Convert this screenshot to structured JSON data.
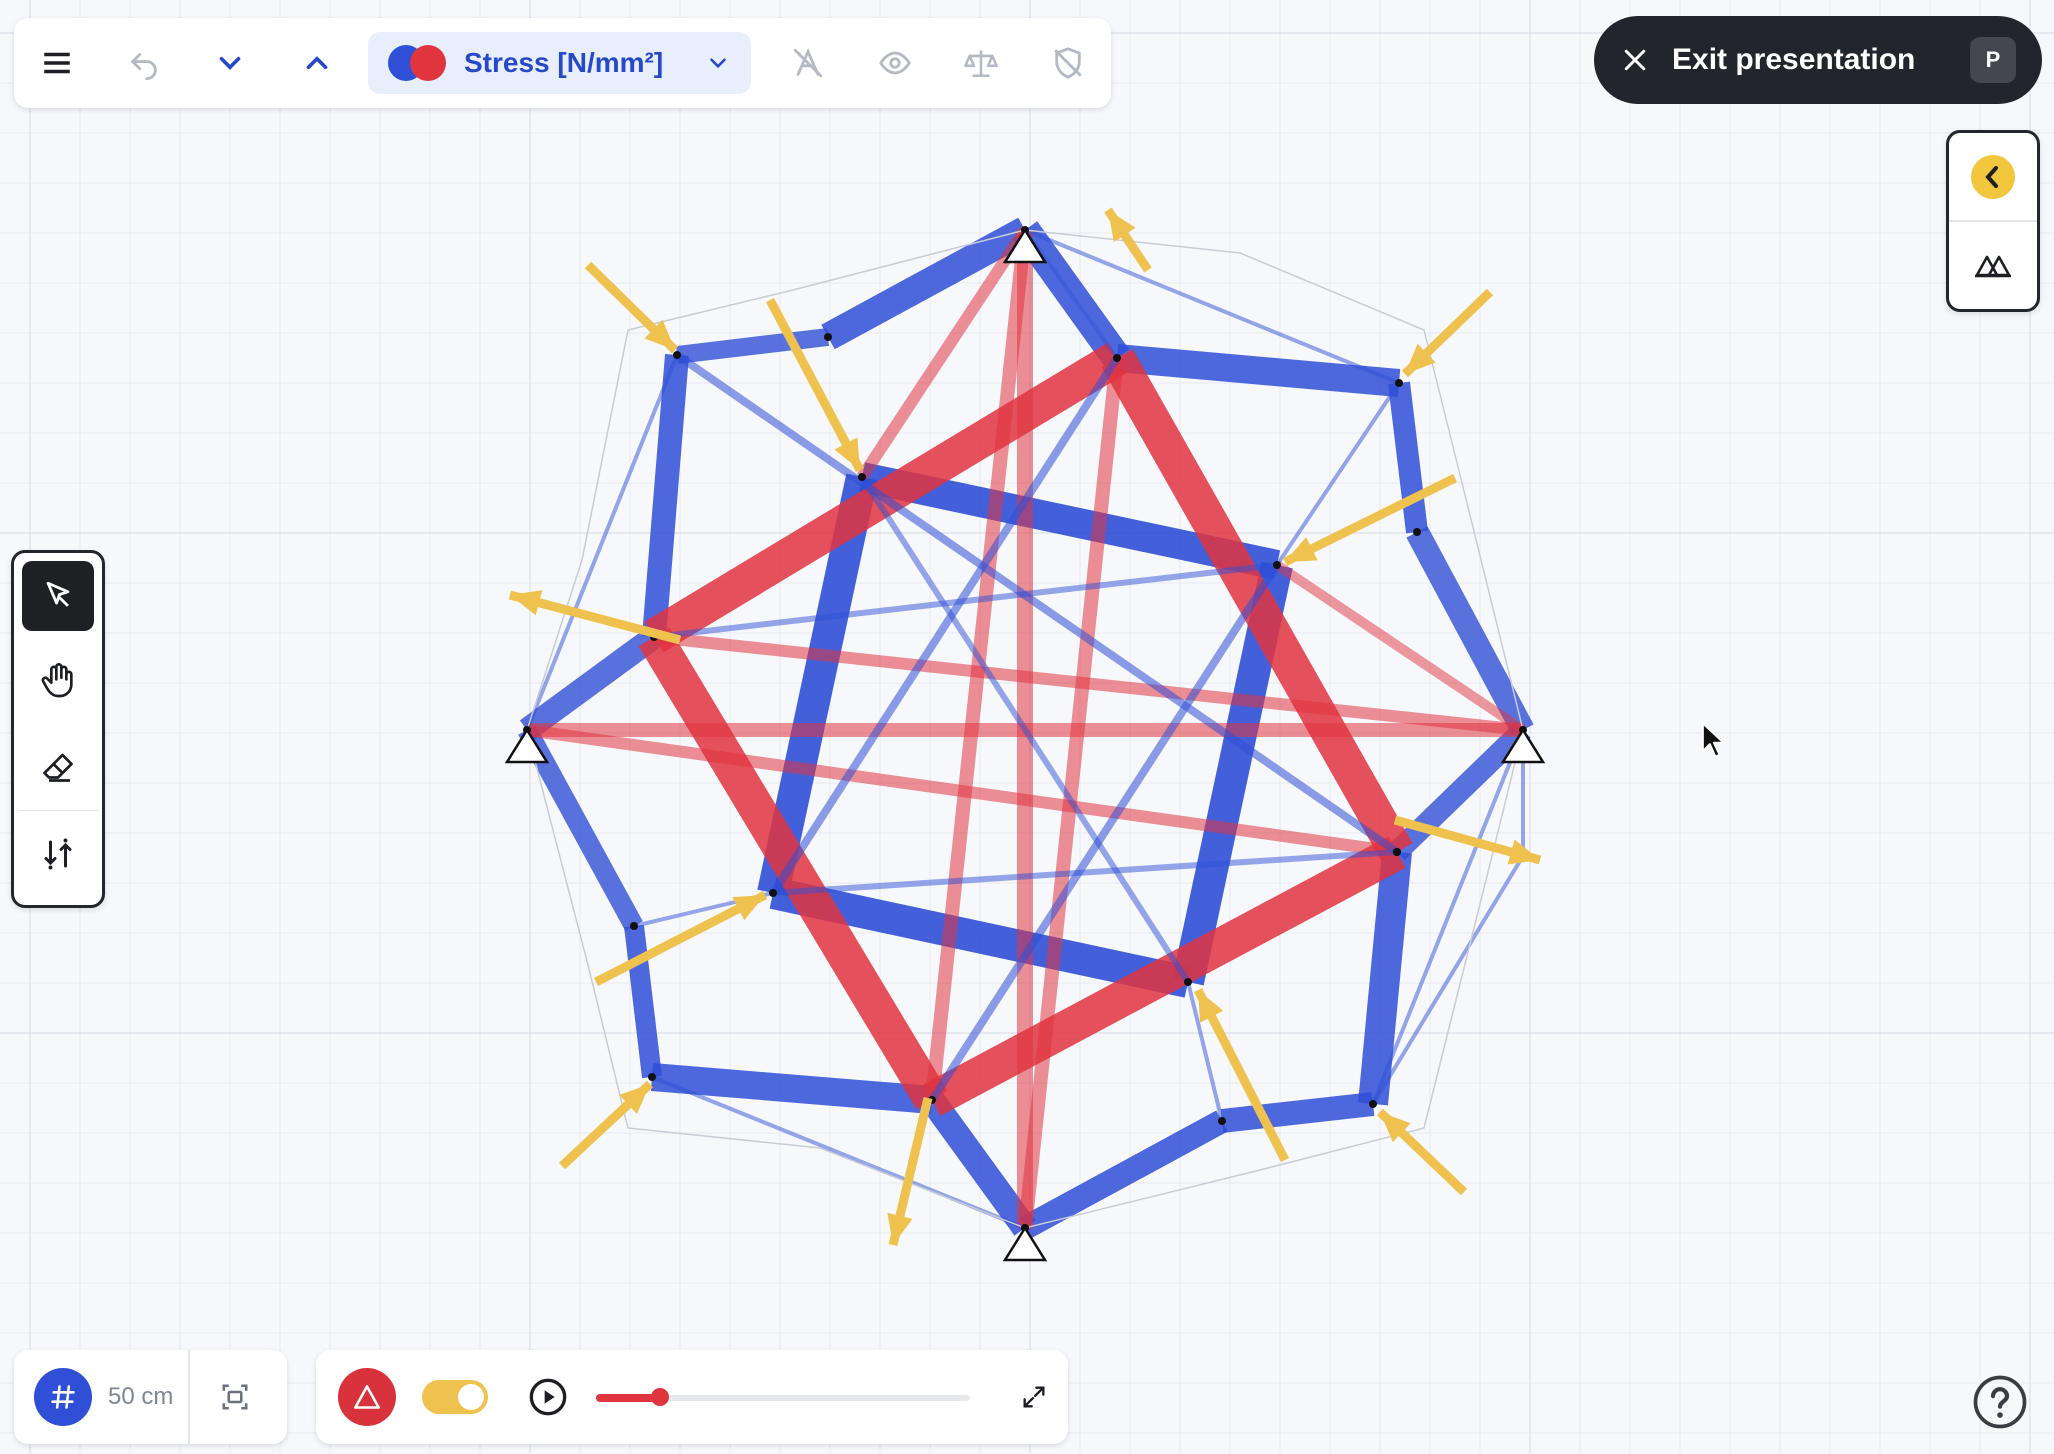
{
  "toolbar": {
    "menu_icon": "hamburger-menu-icon",
    "undo_icon": "undo-icon",
    "previous_icon": "chevron-down-icon",
    "next_icon": "chevron-up-icon",
    "result_selector": {
      "label": "Stress [N/mm²]",
      "colors": [
        "#2f4fd6",
        "#e0343f"
      ],
      "dropdown_icon": "chevron-down-icon"
    },
    "hide_labels_icon": "labels-off-icon",
    "visibility_icon": "eye-icon",
    "equilibrium_icon": "balance-scale-icon",
    "safety_icon": "shield-off-icon"
  },
  "exit_presentation": {
    "label": "Exit presentation",
    "shortcut": "P",
    "close_icon": "close-icon"
  },
  "right_panel": {
    "collapse_icon": "chevron-left-icon",
    "supports_icon": "supports-icon",
    "accent": "#f2c73d"
  },
  "left_tools": [
    {
      "name": "select",
      "icon": "pointer-icon",
      "active": true
    },
    {
      "name": "pan",
      "icon": "hand-icon",
      "active": false
    },
    {
      "name": "erase",
      "icon": "eraser-icon",
      "active": false
    },
    {
      "name": "loads",
      "icon": "load-arrows-icon",
      "active": false
    }
  ],
  "grid_control": {
    "grid_icon": "grid-hash-icon",
    "size_label": "50 cm",
    "fit_icon": "fit-to-screen-icon"
  },
  "playback": {
    "warning_icon": "warning-triangle-icon",
    "toggle_on": true,
    "play_icon": "play-icon",
    "progress": 0.17,
    "expand_icon": "expand-icon"
  },
  "help_icon": "help-icon",
  "colors": {
    "compression": "#2f4fd6",
    "tension": "#e0343f",
    "load": "#efc24f",
    "canvas": "#f7f8fb"
  }
}
